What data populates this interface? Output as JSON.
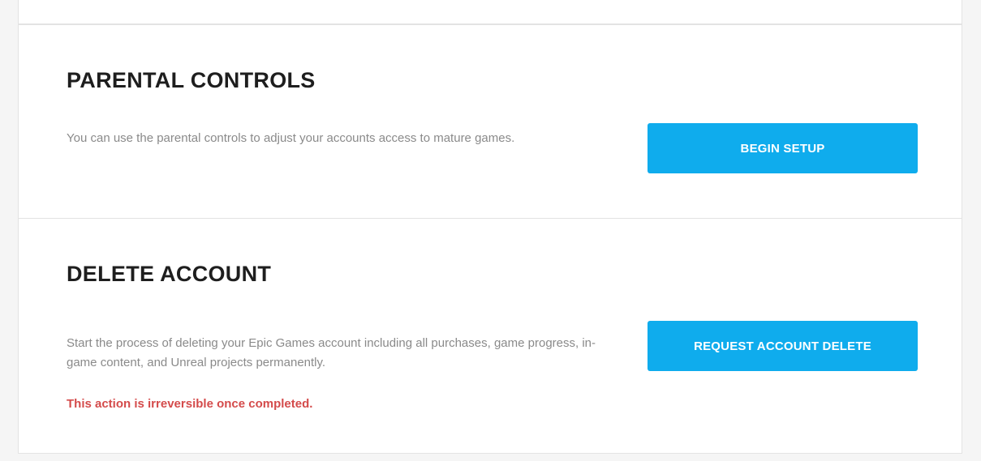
{
  "parental_controls": {
    "title": "PARENTAL CONTROLS",
    "description": "You can use the parental controls to adjust your accounts access to mature games.",
    "button_label": "BEGIN SETUP"
  },
  "delete_account": {
    "title": "DELETE ACCOUNT",
    "description": "Start the process of deleting your Epic Games account including all purchases, game progress, in-game content, and Unreal projects permanently.",
    "warning": "This action is irreversible once completed.",
    "button_label": "REQUEST ACCOUNT DELETE"
  },
  "colors": {
    "accent": "#0faced",
    "warning": "#d44b4b",
    "heading": "#1e1e1e",
    "body_text": "#8a8a8a",
    "background": "#f5f5f5",
    "card": "#ffffff"
  }
}
